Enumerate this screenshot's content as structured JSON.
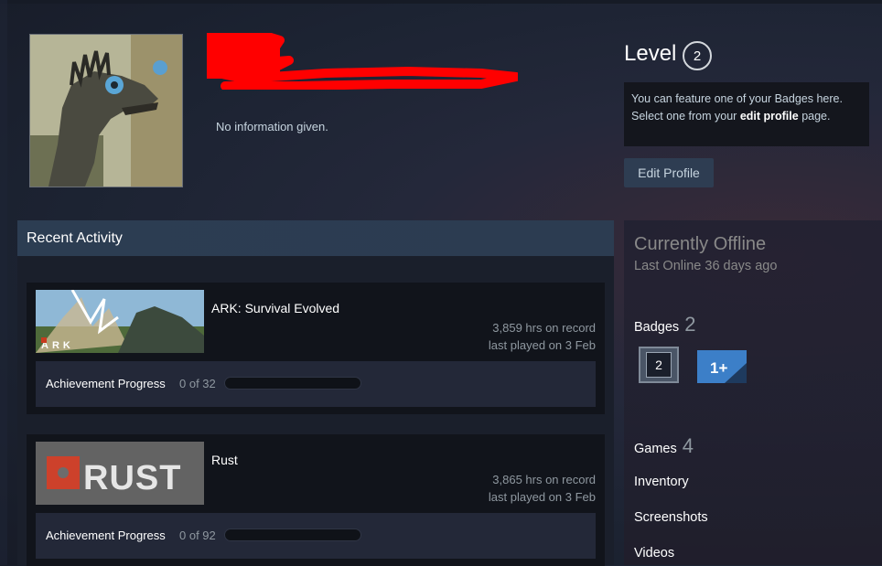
{
  "profile": {
    "summary": "No information given."
  },
  "level": {
    "label": "Level",
    "value": "2"
  },
  "featured_badge": {
    "line1": "You can feature one of your Badges here.",
    "line2_prefix": "Select one from your ",
    "line2_link": "edit profile",
    "line2_suffix": " page."
  },
  "edit_profile_button": "Edit Profile",
  "recent_activity": {
    "title": "Recent Activity",
    "games": [
      {
        "name": "ARK: Survival Evolved",
        "hours": "3,859 hrs on record",
        "last_played": "last played on 3 Feb",
        "ach_label": "Achievement Progress",
        "ach_count": "0 of 32",
        "ach_progress": 0,
        "logo_text": "ARK"
      },
      {
        "name": "Rust",
        "hours": "3,865 hrs on record",
        "last_played": "last played on 3 Feb",
        "ach_label": "Achievement Progress",
        "ach_count": "0 of 92",
        "ach_progress": 0,
        "logo_text": "RUST"
      }
    ]
  },
  "sidebar": {
    "status": "Currently Offline",
    "last_online": "Last Online 36 days ago",
    "badges_label": "Badges",
    "badges_count": "2",
    "badge_level_icon": "2",
    "badge_years_icon": "1+",
    "games_label": "Games",
    "games_count": "4",
    "inventory": "Inventory",
    "screenshots": "Screenshots",
    "videos": "Videos"
  },
  "colors": {
    "header_bg": "#2c3d52",
    "redaction": "#ff0000",
    "button_bg": "#2e3d52"
  }
}
